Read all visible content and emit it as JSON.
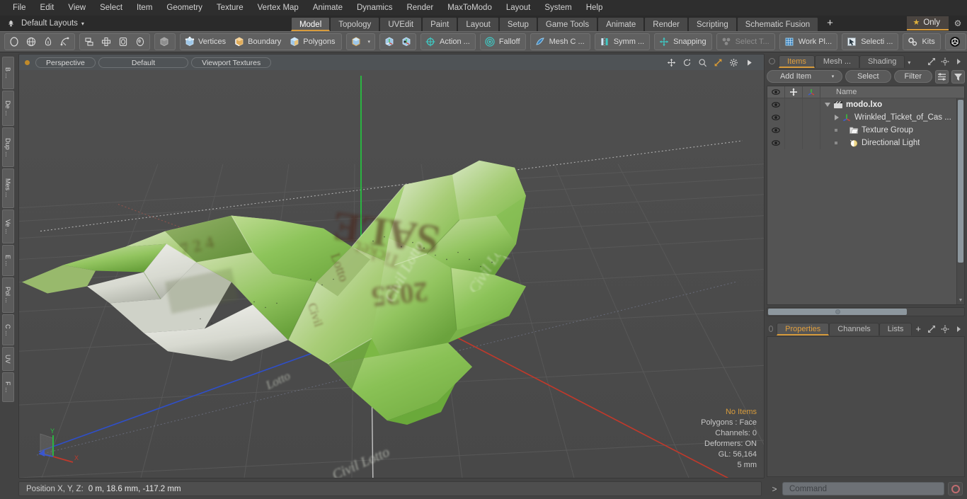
{
  "app": {
    "title": "modo"
  },
  "menubar": {
    "items": [
      "File",
      "Edit",
      "View",
      "Select",
      "Item",
      "Geometry",
      "Texture",
      "Vertex Map",
      "Animate",
      "Dynamics",
      "Render",
      "MaxToModo",
      "Layout",
      "System",
      "Help"
    ]
  },
  "layoutbar": {
    "home_icon": "home-tree-icon",
    "layout_name": "Default Layouts",
    "caret": "▾",
    "tabs": [
      {
        "label": "Model",
        "active": true
      },
      {
        "label": "Topology",
        "active": false
      },
      {
        "label": "UVEdit",
        "active": false
      },
      {
        "label": "Paint",
        "active": false
      },
      {
        "label": "Layout",
        "active": false
      },
      {
        "label": "Setup",
        "active": false
      },
      {
        "label": "Game Tools",
        "active": false
      },
      {
        "label": "Animate",
        "active": false
      },
      {
        "label": "Render",
        "active": false
      },
      {
        "label": "Scripting",
        "active": false
      },
      {
        "label": "Schematic Fusion",
        "active": false
      }
    ],
    "add_tab": "+",
    "only_label": "Only",
    "star_icon": "star-icon",
    "gear_icon": "gear-icon",
    "accent": "#d79b3c"
  },
  "toolbar": {
    "shapes": [
      "circle-shape-icon",
      "globe-shape-icon",
      "pen-shape-icon",
      "curve-shape-icon"
    ],
    "arrangers": [
      "stack-icon",
      "crosshair-grid-icon",
      "square-outline-icon",
      "ellipse-outline-icon"
    ],
    "solid_icon": "solid-cube-icon",
    "selection_modes": [
      {
        "label": "Vertices",
        "icon": "vertices-cube-icon"
      },
      {
        "label": "Boundary",
        "icon": "boundary-cube-icon"
      },
      {
        "label": "Polygons",
        "icon": "polygons-cube-icon"
      }
    ],
    "mode_cube_icon": "cube-icon",
    "mode_caret": "▾",
    "axis_icons": [
      "axis-cube-a-icon",
      "axis-cube-b-icon"
    ],
    "tools": [
      {
        "label": "Action  ...",
        "icon": "action-center-icon",
        "disabled": false
      },
      {
        "label": "Falloff",
        "icon": "falloff-icon",
        "disabled": false
      },
      {
        "label": "Mesh C ...",
        "icon": "mesh-constraint-icon",
        "disabled": false
      },
      {
        "label": "Symm ...",
        "icon": "symmetry-icon",
        "disabled": false
      },
      {
        "label": "Snapping",
        "icon": "snapping-icon",
        "disabled": false
      },
      {
        "label": "Select T...",
        "icon": "select-through-icon",
        "disabled": true
      },
      {
        "label": "Work Pl...",
        "icon": "work-plane-icon",
        "disabled": false
      },
      {
        "label": "Selecti ...",
        "icon": "selection-arrow-icon",
        "disabled": false
      }
    ],
    "kits": {
      "label": "Kits",
      "icon": "kits-gears-icon"
    },
    "right_icons": [
      "substance-cube-icon",
      "unreal-engine-icon"
    ]
  },
  "left_vtabs": [
    {
      "label": "B ..."
    },
    {
      "label": "De ..."
    },
    {
      "label": "Dup ..."
    },
    {
      "label": "Mes ..."
    },
    {
      "label": "Ve ..."
    },
    {
      "label": "E ..."
    },
    {
      "label": "Pol ..."
    },
    {
      "label": "C ..."
    },
    {
      "label": "UV"
    },
    {
      "label": "F ..."
    }
  ],
  "viewport": {
    "header": {
      "view_mode": "Perspective",
      "preset": "Default",
      "shading": "Viewport Textures",
      "nav_icons": [
        "move-view-icon",
        "rotate-view-icon",
        "zoom-view-icon",
        "fit-view-icon",
        "viewport-settings-icon",
        "viewport-play-icon"
      ]
    },
    "stats": [
      {
        "text": "No Items",
        "highlight": true
      },
      {
        "text": "Polygons : Face",
        "highlight": false
      },
      {
        "text": "Channels: 0",
        "highlight": false
      },
      {
        "text": "Deformers: ON",
        "highlight": false
      },
      {
        "text": "GL: 56,164",
        "highlight": false
      },
      {
        "text": "5 mm",
        "highlight": false
      }
    ],
    "gizmo": {
      "x_label": "X",
      "y_label": "Y",
      "x_color": "#c0392b",
      "y_color": "#27c040",
      "z_color": "#3a56d0"
    },
    "model": {
      "description": "crumpled green lottery ticket mesh",
      "texture_words": [
        "Civil Lotto",
        "Civil Lotto",
        "SALE"
      ],
      "base_color": "#8fc457",
      "light_color": "#e8eedc"
    }
  },
  "right_panel": {
    "top_tabs": [
      {
        "label": "Items",
        "active": true
      },
      {
        "label": "Mesh ...",
        "active": false
      },
      {
        "label": "Shading",
        "active": false
      }
    ],
    "top_tab_caret": "▾",
    "top_tab_icons": [
      "expand-panel-icon",
      "gear-icon",
      "panel-arrow-icon"
    ],
    "item_toolbar": {
      "add_item": "Add Item",
      "add_item_caret": "▾",
      "select": "Select",
      "filter": "Filter",
      "icons": [
        "list-options-icon",
        "funnel-filter-icon"
      ]
    },
    "list_header": {
      "col_icons": [
        "eye-icon",
        "move-cross-icon",
        "axis-icon"
      ],
      "name": "Name"
    },
    "items": [
      {
        "label": "modo.lxo",
        "icon": "scene-clapper-icon",
        "depth": 0,
        "expander": "down",
        "root": true
      },
      {
        "label": "Wrinkled_Ticket_of_Cas ...",
        "icon": "mesh-axis-icon",
        "depth": 1,
        "expander": "right",
        "root": false
      },
      {
        "label": "Texture Group",
        "icon": "texture-group-icon",
        "depth": 1,
        "expander": "dot",
        "root": false
      },
      {
        "label": "Directional Light",
        "icon": "directional-light-icon",
        "depth": 1,
        "expander": "dot",
        "root": false
      }
    ],
    "bottom_tabs": [
      {
        "label": "Properties",
        "active": true
      },
      {
        "label": "Channels",
        "active": false
      },
      {
        "label": "Lists",
        "active": false
      }
    ],
    "bottom_tab_plus": "+",
    "bottom_tab_icons": [
      "expand-panel-icon",
      "gear-icon",
      "panel-arrow-icon"
    ]
  },
  "bottom": {
    "status_label": "Position X, Y, Z:",
    "status_value": "0 m, 18.6 mm, -117.2 mm",
    "command_prompt": ">",
    "command_placeholder": "Command",
    "record_icon": "record-icon"
  }
}
